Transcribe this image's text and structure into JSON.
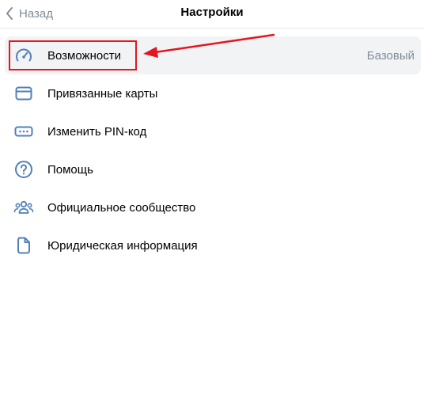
{
  "header": {
    "back_label": "Назад",
    "title": "Настройки",
    "back_icon": "chevron-left-icon"
  },
  "menu": {
    "items": [
      {
        "label": "Возможности",
        "value": "Базовый",
        "icon": "speedometer-icon",
        "active": true
      },
      {
        "label": "Привязанные карты",
        "icon": "credit-card-icon"
      },
      {
        "label": "Изменить PIN-код",
        "icon": "pin-code-icon"
      },
      {
        "label": "Помощь",
        "icon": "help-circle-icon"
      },
      {
        "label": "Официальное сообщество",
        "icon": "community-icon"
      },
      {
        "label": "Юридическая информация",
        "icon": "document-icon"
      }
    ]
  },
  "colors": {
    "accent": "#3f8ae0",
    "icon": "#5181b8",
    "secondary_text": "#818c99",
    "active_bg": "#f2f3f5",
    "annotation": "#e4161e"
  }
}
